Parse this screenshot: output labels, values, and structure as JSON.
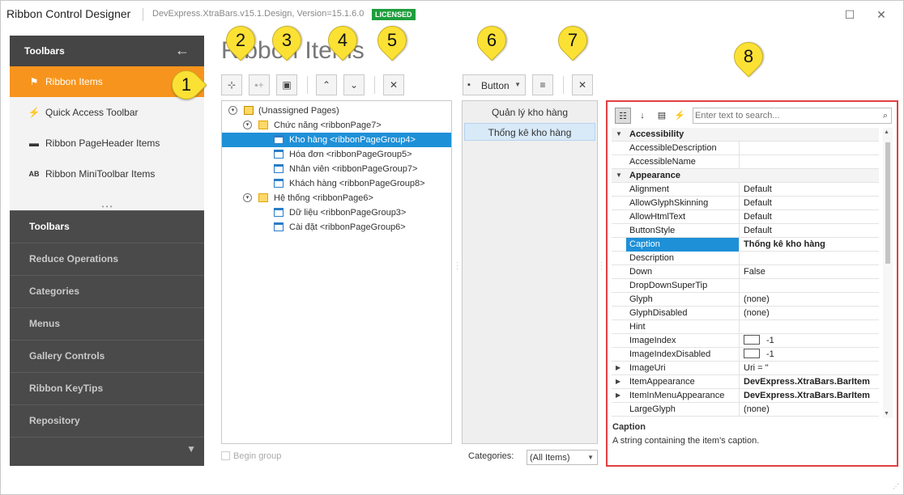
{
  "window": {
    "title": "Ribbon Control Designer",
    "version": "DevExpress.XtraBars.v15.1.Design, Version=15.1.6.0",
    "license": "LICENSED",
    "maximize_icon": "maximize-icon",
    "close_icon": "close-icon"
  },
  "nav": {
    "header": "Toolbars",
    "items": [
      {
        "label": "Ribbon Items",
        "icon": "ribbon-items-icon",
        "active": true
      },
      {
        "label": "Quick Access Toolbar",
        "icon": "lightning-icon"
      },
      {
        "label": "Ribbon PageHeader Items",
        "icon": "page-header-icon"
      },
      {
        "label": "Ribbon MiniToolbar Items",
        "icon": "mini-toolbar-icon"
      }
    ],
    "groups": [
      "Toolbars",
      "Reduce Operations",
      "Categories",
      "Menus",
      "Gallery Controls",
      "Ribbon KeyTips",
      "Repository"
    ]
  },
  "main": {
    "title": "Ribbon Items",
    "toolbar_icons": [
      "add-page-icon",
      "add-group-icon",
      "add-category-icon",
      "move-up-icon",
      "move-down-icon",
      "delete-icon"
    ],
    "item_button": "Button",
    "tree": [
      {
        "text": "(Unassigned Pages)",
        "level": 0
      },
      {
        "text": "Chức năng  <ribbonPage7>",
        "level": 1
      },
      {
        "text": "Kho hàng  <ribbonPageGroup4>",
        "level": 2,
        "selected": true
      },
      {
        "text": "Hóa đơn  <ribbonPageGroup5>",
        "level": 2
      },
      {
        "text": "Nhân viên  <ribbonPageGroup7>",
        "level": 2
      },
      {
        "text": "Khách hàng  <ribbonPageGroup8>",
        "level": 2
      },
      {
        "text": "Hệ thống  <ribbonPage6>",
        "level": 1
      },
      {
        "text": "Dữ liệu  <ribbonPageGroup3>",
        "level": 2
      },
      {
        "text": "Cài đặt  <ribbonPageGroup6>",
        "level": 2
      }
    ],
    "begin_group": "Begin group",
    "items_list": [
      "Quản lý kho hàng",
      "Thống kê kho hàng"
    ],
    "categories_label": "Categories:",
    "categories_value": "(All Items)"
  },
  "properties": {
    "search_placeholder": "Enter text to search...",
    "rows": [
      {
        "name": "Accessibility",
        "category": true
      },
      {
        "name": "AccessibleDescription",
        "value": ""
      },
      {
        "name": "AccessibleName",
        "value": ""
      },
      {
        "name": "Appearance",
        "category": true
      },
      {
        "name": "Alignment",
        "value": "Default"
      },
      {
        "name": "AllowGlyphSkinning",
        "value": "Default"
      },
      {
        "name": "AllowHtmlText",
        "value": "Default"
      },
      {
        "name": "ButtonStyle",
        "value": "Default"
      },
      {
        "name": "Caption",
        "value": "Thống kê kho hàng",
        "selected": true
      },
      {
        "name": "Description",
        "value": ""
      },
      {
        "name": "Down",
        "value": "False"
      },
      {
        "name": "DropDownSuperTip",
        "value": ""
      },
      {
        "name": "Glyph",
        "value": "(none)"
      },
      {
        "name": "GlyphDisabled",
        "value": "(none)"
      },
      {
        "name": "Hint",
        "value": ""
      },
      {
        "name": "ImageIndex",
        "value": "-1"
      },
      {
        "name": "ImageIndexDisabled",
        "value": "-1"
      },
      {
        "name": "ImageUri",
        "value": "Uri = ''"
      },
      {
        "name": "ItemAppearance",
        "value": "DevExpress.XtraBars.BarItem"
      },
      {
        "name": "ItemInMenuAppearance",
        "value": "DevExpress.XtraBars.BarItem"
      },
      {
        "name": "LargeGlyph",
        "value": "(none)"
      }
    ],
    "desc_title": "Caption",
    "desc_text": "A string containing the item's caption."
  },
  "callouts": [
    "1",
    "2",
    "3",
    "4",
    "5",
    "6",
    "7",
    "8"
  ],
  "colors": {
    "accent": "#f7941d",
    "selection": "#1e90d8",
    "callout": "#fce135",
    "frame": "#e04040",
    "license": "#1e9e3c"
  }
}
